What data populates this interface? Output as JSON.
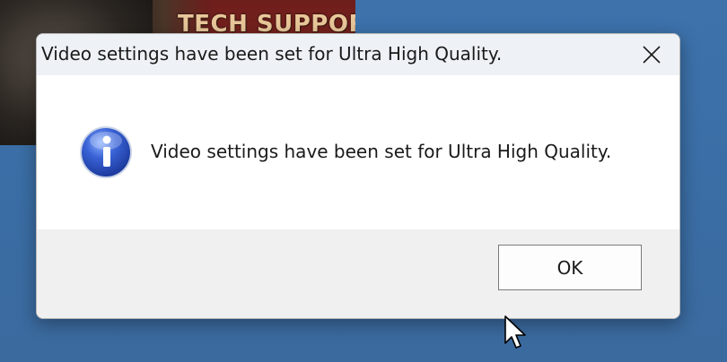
{
  "background": {
    "art_title": "TECH SUPPORT",
    "desktop_color": "#3a6fa6"
  },
  "dialog": {
    "title": "Video settings have been set for Ultra High Quality.",
    "message": "Video settings have been set for Ultra High Quality.",
    "icon": "info-icon",
    "close_icon": "close-icon",
    "ok_label": "OK"
  },
  "cursor": {
    "icon": "mouse-pointer-icon"
  }
}
